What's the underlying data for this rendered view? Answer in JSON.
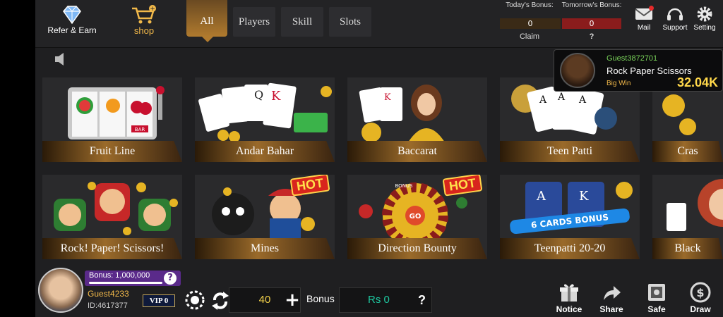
{
  "header": {
    "refer_label": "Refer & Earn",
    "shop_label": "shop",
    "tabs": [
      {
        "label": "All",
        "active": true
      },
      {
        "label": "Players",
        "active": false
      },
      {
        "label": "Skill",
        "active": false
      },
      {
        "label": "Slots",
        "active": false
      }
    ],
    "bonus": {
      "today_label": "Today's Bonus:",
      "today_value": "0",
      "tomorrow_label": "Tomorrow's Bonus:",
      "tomorrow_value": "0",
      "claim_label": "Claim",
      "question": "?"
    },
    "icons": [
      {
        "name": "mail-icon",
        "label": "Mail"
      },
      {
        "name": "support-icon",
        "label": "Support"
      },
      {
        "name": "setting-icon",
        "label": "Setting"
      }
    ]
  },
  "games": [
    {
      "label": "Fruit Line"
    },
    {
      "label": "Andar Bahar"
    },
    {
      "label": "Baccarat"
    },
    {
      "label": "Teen Patti"
    },
    {
      "label": "Cras"
    },
    {
      "label": "Rock! Paper! Scissors!"
    },
    {
      "label": "Mines",
      "hot": "HOT"
    },
    {
      "label": "Direction Bounty",
      "hot": "HOT"
    },
    {
      "label": "Teenpatti 20-20"
    },
    {
      "label": "Black"
    }
  ],
  "card_texts": {
    "bar": "BAR",
    "go": "GO",
    "bonus_wheel": "BONUS",
    "cards_bonus": "6 CARDS BONUS"
  },
  "winner": {
    "name": "Guest3872701",
    "game": "Rock Paper Scissors",
    "badge": "Big Win",
    "amount": "32.04K"
  },
  "footer": {
    "bonus_text": "Bonus: 1,000,000",
    "question": "?",
    "guest_name": "Guest4233",
    "guest_id": "ID:4617377",
    "vip": "VIP 0",
    "coins": "40",
    "bonus_label": "Bonus",
    "rs_value": "Rs 0",
    "rs_question": "?",
    "icons": [
      {
        "name": "notice-icon",
        "label": "Notice"
      },
      {
        "name": "share-icon",
        "label": "Share"
      },
      {
        "name": "safe-icon",
        "label": "Safe"
      },
      {
        "name": "draw-icon",
        "label": "Draw"
      }
    ]
  },
  "colors": {
    "gold": "#f2b94a",
    "background": "#1f1f21",
    "bonus_purple": "#5a2a8a",
    "rs_teal": "#1ec8a0",
    "win_green": "#7ad35a"
  }
}
